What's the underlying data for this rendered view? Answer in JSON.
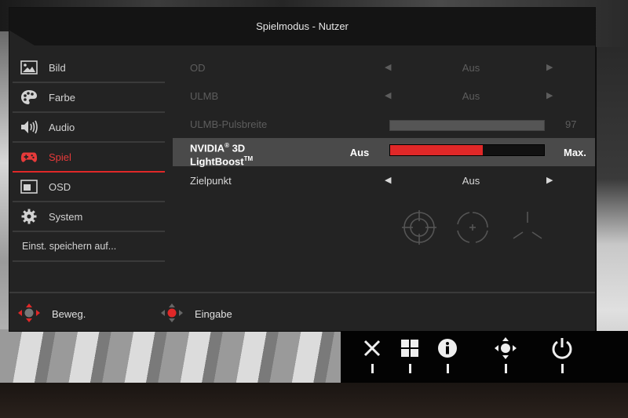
{
  "osd": {
    "title": "Spielmodus - Nutzer",
    "sidebar": [
      {
        "label": "Bild",
        "icon": "picture-icon"
      },
      {
        "label": "Farbe",
        "icon": "palette-icon"
      },
      {
        "label": "Audio",
        "icon": "speaker-icon"
      },
      {
        "label": "Spiel",
        "icon": "gamepad-icon",
        "active": true
      },
      {
        "label": "OSD",
        "icon": "osd-window-icon"
      },
      {
        "label": "System",
        "icon": "gear-icon"
      },
      {
        "label": "Einst. speichern auf..."
      }
    ],
    "settings": {
      "od": {
        "label": "OD",
        "value": "Aus"
      },
      "ulmb": {
        "label": "ULMB",
        "value": "Aus"
      },
      "ulmb_pulse": {
        "label": "ULMB-Pulsbreite",
        "value": "97",
        "level_percent": 97
      },
      "lightboost": {
        "label_line1": "NVIDIA",
        "label_sup1": "®",
        "label_line1b": " 3D",
        "label_line2": "LightBoost",
        "label_sup2": "TM",
        "left_value": "Aus",
        "right_value": "Max.",
        "level_percent": 60
      },
      "crosshair": {
        "label": "Zielpunkt",
        "value": "Aus"
      }
    },
    "footer": {
      "move_label": "Beweg.",
      "enter_label": "Eingabe"
    }
  },
  "hardware_buttons": [
    {
      "icon": "close-icon"
    },
    {
      "icon": "grid-icon"
    },
    {
      "icon": "info-icon"
    },
    {
      "icon": "joystick-icon"
    },
    {
      "icon": "power-icon"
    }
  ],
  "colors": {
    "accent": "#e02828",
    "panel": "#232323",
    "selected_row": "#4a4a4a"
  }
}
